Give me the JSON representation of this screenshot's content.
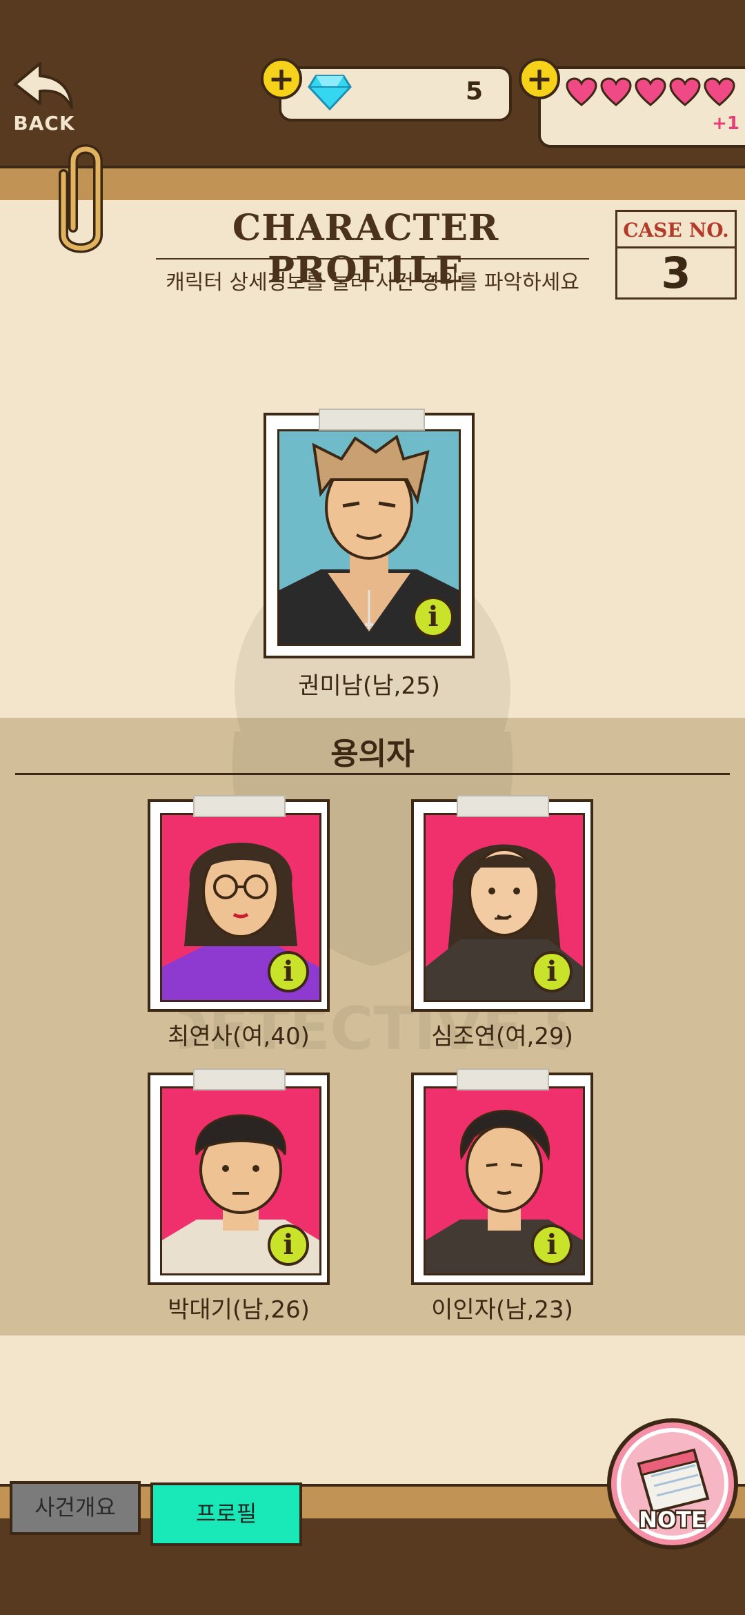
{
  "header": {
    "back_label": "BACK",
    "gem_count": "5",
    "hearts": 5,
    "heart_bonus": "+1"
  },
  "profile": {
    "title": "CHARACTER PROF1LE",
    "subtitle": "캐릭터 상세정보를 눌러 사건 경위를 파악하세요",
    "case_label": "CASE NO.",
    "case_number": "3"
  },
  "victim": {
    "caption": "권미남(남,25)",
    "info_label": "i"
  },
  "suspects_title": "용의자",
  "suspects": [
    {
      "caption": "최연사(여,40)",
      "info_label": "i"
    },
    {
      "caption": "심조연(여,29)",
      "info_label": "i"
    },
    {
      "caption": "박대기(남,26)",
      "info_label": "i"
    },
    {
      "caption": "이인자(남,23)",
      "info_label": "i"
    }
  ],
  "tabs": {
    "overview": "사건개요",
    "profile": "프로필"
  },
  "note_label": "NOTE",
  "watermark_text": "DETECTIVE S",
  "colors": {
    "wood": "#573a20",
    "paper": "#f2e5cc",
    "accent_tab": "#19e8b8",
    "info": "#c9e32a",
    "pink_bg": "#f0306c",
    "blue_bg": "#6fbbc9"
  }
}
